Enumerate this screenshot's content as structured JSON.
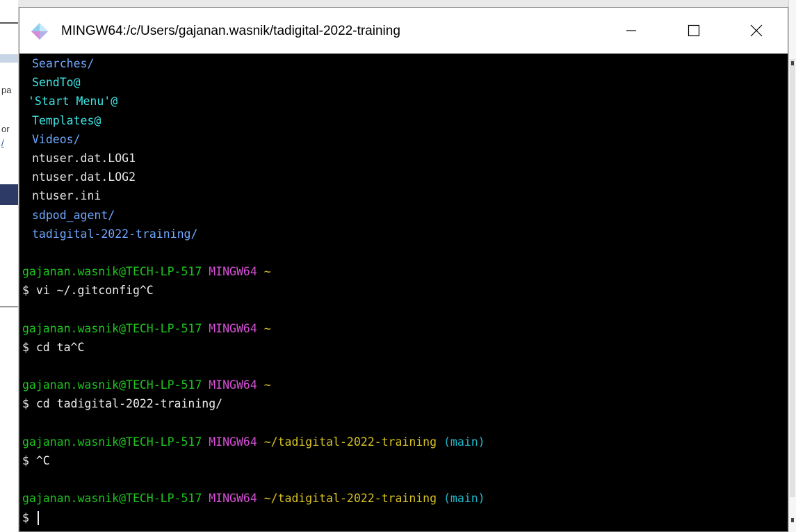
{
  "window": {
    "title": "MINGW64:/c/Users/gajanan.wasnik/tadigital-2022-training"
  },
  "background_fragments": {
    "f1": "pa",
    "f2": "or",
    "f3": "/"
  },
  "listing": [
    {
      "text": "Searches/",
      "color": "#6fa8ff",
      "kind": "dir"
    },
    {
      "text": "SendTo@",
      "color": "#3ee6e6",
      "kind": "link"
    },
    {
      "text": "'Start Menu'@",
      "color": "#3ee6e6",
      "kind": "link",
      "quoted": true
    },
    {
      "text": "Templates@",
      "color": "#3ee6e6",
      "kind": "link"
    },
    {
      "text": "Videos/",
      "color": "#6fa8ff",
      "kind": "dir"
    },
    {
      "text": "ntuser.dat.LOG1",
      "color": "#e6e6e6",
      "kind": "file"
    },
    {
      "text": "ntuser.dat.LOG2",
      "color": "#e6e6e6",
      "kind": "file"
    },
    {
      "text": "ntuser.ini",
      "color": "#e6e6e6",
      "kind": "file"
    },
    {
      "text": "sdpod_agent/",
      "color": "#6fa8ff",
      "kind": "dir"
    },
    {
      "text": "tadigital-2022-training/",
      "color": "#6fa8ff",
      "kind": "dir"
    }
  ],
  "sessions": [
    {
      "user": "gajanan.wasnik@TECH-LP-517",
      "env": "MINGW64",
      "path": "~",
      "branch": "",
      "command": "$ vi ~/.gitconfig^C"
    },
    {
      "user": "gajanan.wasnik@TECH-LP-517",
      "env": "MINGW64",
      "path": "~",
      "branch": "",
      "command": "$ cd ta^C"
    },
    {
      "user": "gajanan.wasnik@TECH-LP-517",
      "env": "MINGW64",
      "path": "~",
      "branch": "",
      "command": "$ cd tadigital-2022-training/"
    },
    {
      "user": "gajanan.wasnik@TECH-LP-517",
      "env": "MINGW64",
      "path": "~/tadigital-2022-training",
      "branch": "(main)",
      "command": "$ ^C"
    },
    {
      "user": "gajanan.wasnik@TECH-LP-517",
      "env": "MINGW64",
      "path": "~/tadigital-2022-training",
      "branch": "(main)",
      "command": "$ "
    }
  ],
  "colors": {
    "prompt_user": "#1ec41e",
    "prompt_env": "#d24fd2",
    "prompt_path": "#d7c321",
    "prompt_branch": "#1fb7c9",
    "terminal_bg": "#000000"
  },
  "icons": {
    "app": "git-bash-diamond-icon",
    "minimize": "minimize-icon",
    "maximize": "maximize-icon",
    "close": "close-icon"
  }
}
